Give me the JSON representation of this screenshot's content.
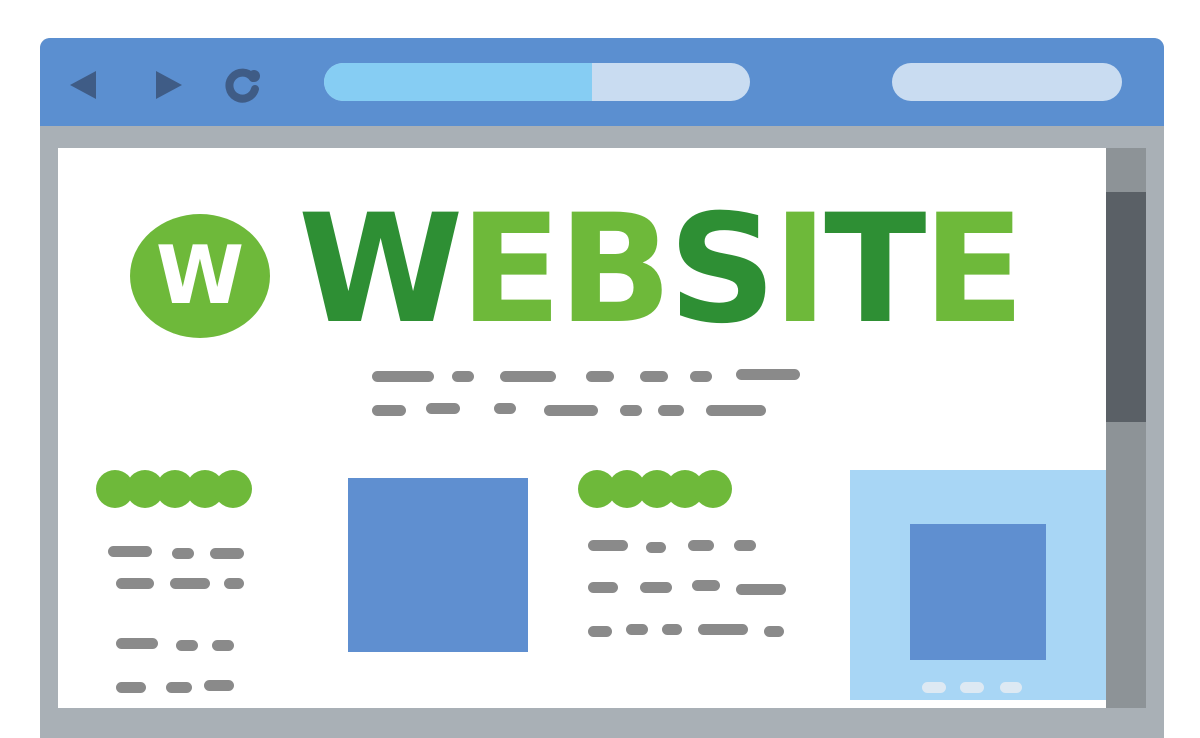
{
  "browser": {
    "title_bar_color": "#5b8fd0",
    "back_icon": "triangle-left-icon",
    "forward_icon": "triangle-right-icon",
    "reload_icon": "reload-icon",
    "page_load_progress": 0.63,
    "icon_color": "#3f5c86"
  },
  "page": {
    "logo": {
      "letter": "W",
      "color": "#6eb93a"
    },
    "title": "WEBSITE",
    "title_colors": {
      "dark": "#2e8f34",
      "light": "#6eb93a"
    },
    "body_text_color": "#8a8a8a",
    "image_placeholder_color": "#5f8fd0",
    "side_panel_color": "#a8d6f5"
  }
}
